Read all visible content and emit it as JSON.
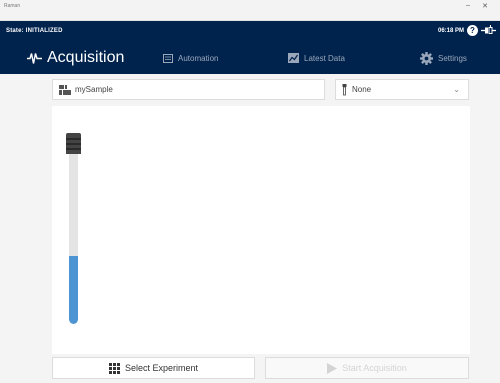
{
  "window": {
    "app_title": "Raman",
    "minimize": "–",
    "close": "✕"
  },
  "header": {
    "state": "State: INITIALIZED",
    "time": "06:18 PM",
    "help": "?"
  },
  "nav": {
    "acquisition": "Acquisition",
    "automation": "Automation",
    "latest_data": "Latest Data",
    "settings": "Settings"
  },
  "sample": {
    "name": "mySample"
  },
  "probe_select": {
    "value": "None"
  },
  "sample_tube": {
    "fill_fraction": 0.4
  },
  "buttons": {
    "select_experiment": "Select Experiment",
    "start_acquisition": "Start Acquisition"
  },
  "colors": {
    "header_bg": "#00234e",
    "tube_fill": "#4c95d2",
    "panel_bg": "#f4f4f4"
  }
}
